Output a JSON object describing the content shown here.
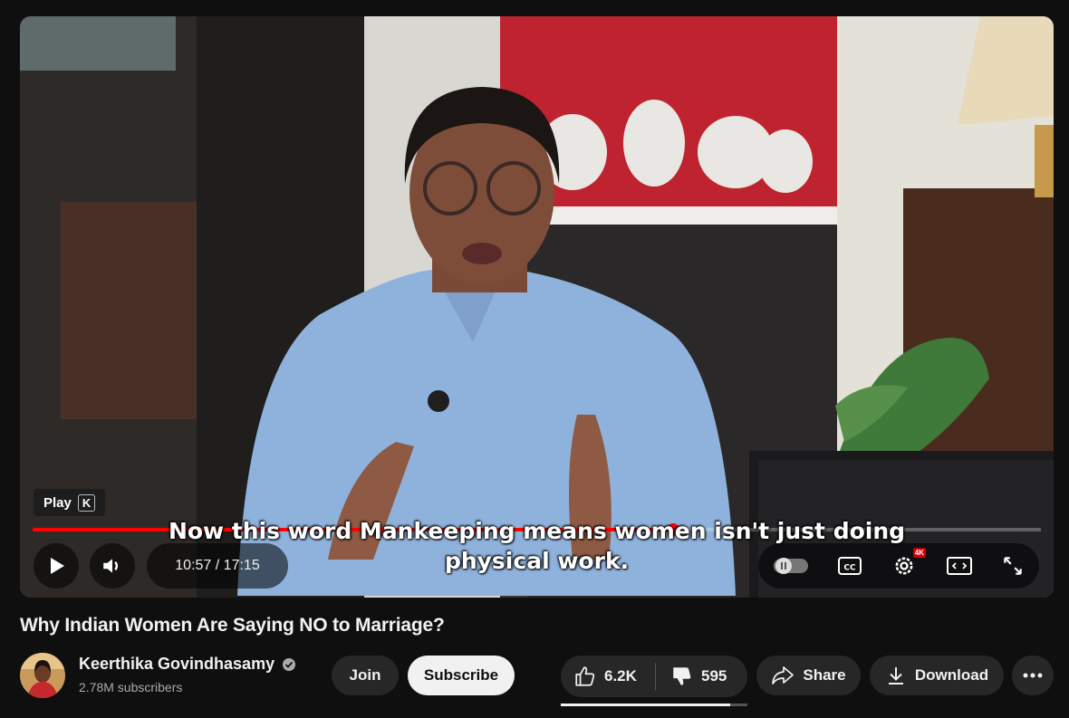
{
  "player": {
    "tooltip_label": "Play",
    "tooltip_key": "K",
    "current_time": "10:57",
    "time_separator": " / ",
    "duration": "17:15",
    "progress_fraction": 0.635,
    "caption_line1": "Now this word Mankeeping means women isn't just doing",
    "caption_line2": "physical work.",
    "settings_badge": "4K",
    "accent_color": "#ff0000",
    "icons": [
      "play-icon",
      "volume-icon",
      "autoplay-toggle",
      "cc-icon",
      "settings-icon",
      "theater-icon",
      "fullscreen-icon"
    ]
  },
  "video": {
    "title": "Why Indian Women Are Saying NO to Marriage?"
  },
  "channel": {
    "name": "Keerthika Govindhasamy",
    "subscribers": "2.78M subscribers",
    "verified_icon": "verified-check-icon"
  },
  "actions": {
    "join_label": "Join",
    "subscribe_label": "Subscribe",
    "like_count": "6.2K",
    "dislike_count": "595",
    "like_ratio": 0.91,
    "share_label": "Share",
    "download_label": "Download",
    "more_icon": "more-horizontal-icon"
  }
}
